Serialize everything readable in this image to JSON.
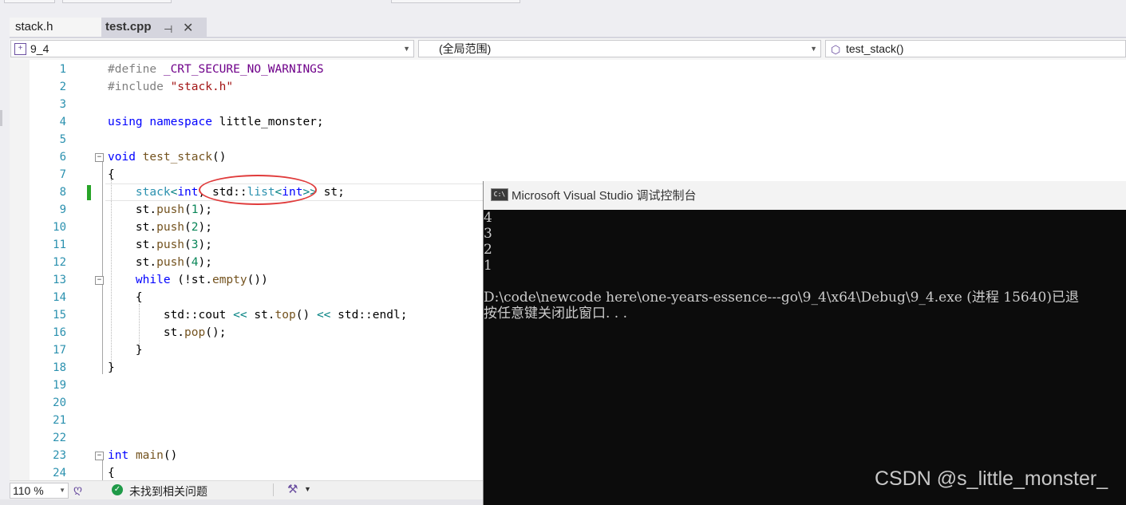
{
  "tabs": [
    {
      "label": "stack.h"
    },
    {
      "label": "test.cpp"
    }
  ],
  "tab_pin_glyph": "⊣",
  "tab_close_glyph": "✕",
  "navbar": {
    "project": "9_4",
    "scope": "(全局范围)",
    "member": "test_stack()"
  },
  "line_numbers": [
    "1",
    "2",
    "3",
    "4",
    "5",
    "6",
    "7",
    "8",
    "9",
    "10",
    "11",
    "12",
    "13",
    "14",
    "15",
    "16",
    "17",
    "18",
    "19",
    "20",
    "21",
    "22",
    "23",
    "24"
  ],
  "code_lines": [
    "#define _CRT_SECURE_NO_WARNINGS",
    "#include \"stack.h\"",
    "",
    "using namespace little_monster;",
    "",
    "void test_stack()",
    "{",
    "    stack<int, std::list<int>> st;",
    "    st.push(1);",
    "    st.push(2);",
    "    st.push(3);",
    "    st.push(4);",
    "    while (!st.empty())",
    "    {",
    "        std::cout << st.top() << std::endl;",
    "        st.pop();",
    "    }",
    "}",
    "",
    "",
    "",
    "",
    "int main()",
    "{"
  ],
  "statusbar": {
    "zoom": "110 %",
    "issues": "未找到相关问题"
  },
  "console": {
    "title": "Microsoft Visual Studio 调试控制台",
    "icon_label": "C:\\",
    "lines": [
      "4",
      "3",
      "2",
      "1",
      "",
      "D:\\code\\newcode here\\one-years-essence---go\\9_4\\x64\\Debug\\9_4.exe (进程 15640)已退",
      "按任意键关闭此窗口. . ."
    ]
  },
  "watermark": "CSDN @s_little_monster_"
}
